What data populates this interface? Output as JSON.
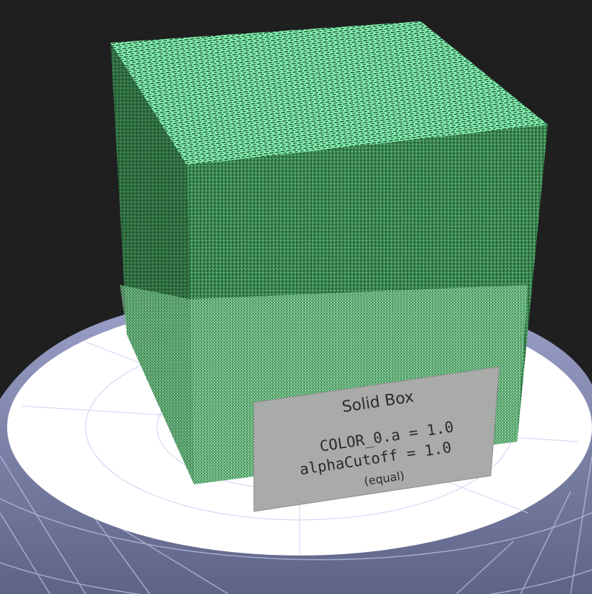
{
  "scene": {
    "background_color": "#1f1f1f",
    "pedestal_top_color": "#ffffff",
    "pedestal_side_color": "#8f96b8",
    "grid_color": "#aab0d8",
    "cube_color_light": "#7ff2b0",
    "cube_color_mid": "#4fb06c",
    "cube_color_dark": "#2e6e3f"
  },
  "sign": {
    "title": "Solid Box",
    "line1": "COLOR_0.a = 1.0",
    "line2": "alphaCutoff = 1.0",
    "line3": "(equal)",
    "color": "#a9aba9"
  }
}
